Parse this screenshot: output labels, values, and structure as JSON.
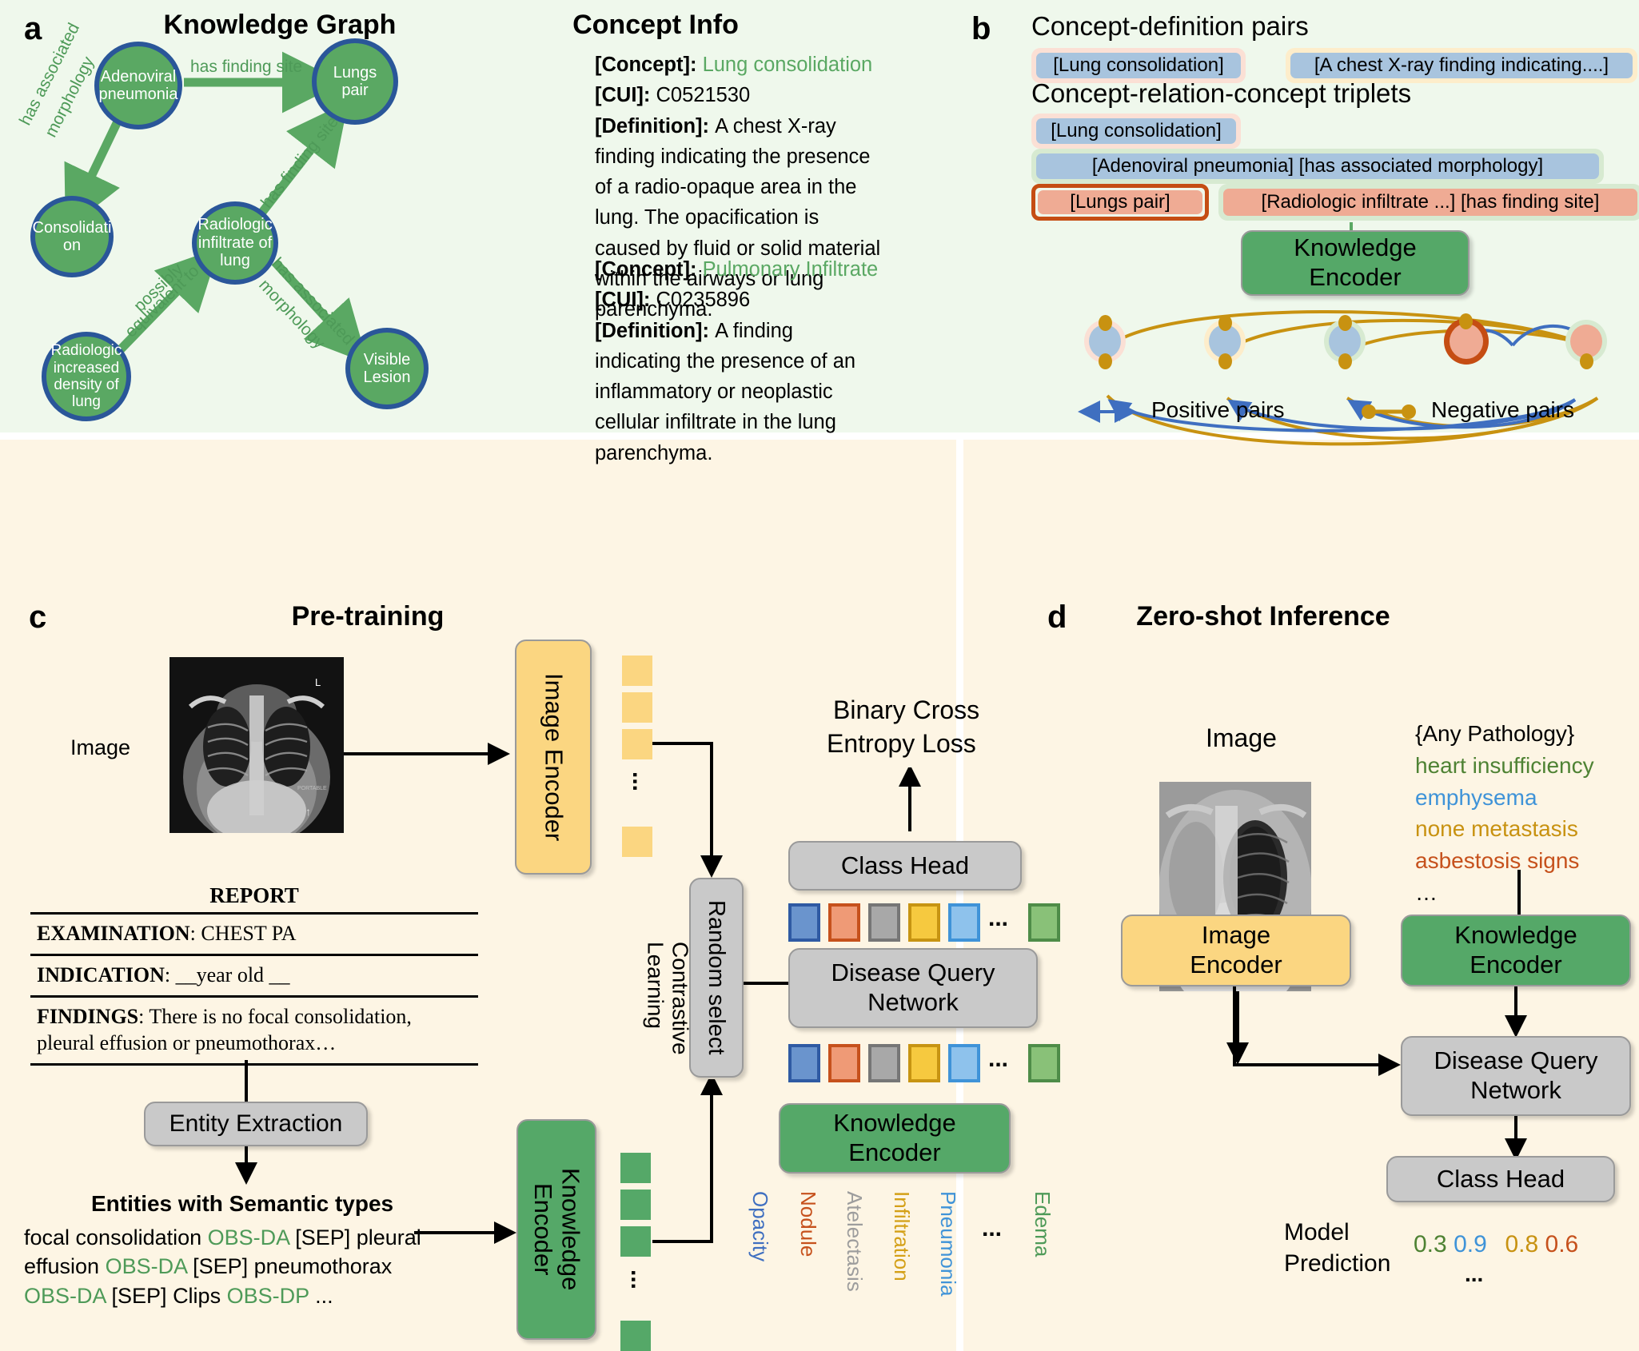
{
  "panels": {
    "a": {
      "letter": "a",
      "title": "Knowledge Graph"
    },
    "b": {
      "letter": "b"
    },
    "c": {
      "letter": "c",
      "title": "Pre-training"
    },
    "d": {
      "letter": "d",
      "title": "Zero-shot Inference"
    }
  },
  "knowledge_graph": {
    "nodes": [
      {
        "id": "adenoviral",
        "label": "Adenoviral pneumonia"
      },
      {
        "id": "lungs_pair",
        "label": "Lungs pair"
      },
      {
        "id": "consolidation",
        "label": "Consolidati on"
      },
      {
        "id": "radiologic_infiltrate",
        "label": "Radiologic infiltrate of lung"
      },
      {
        "id": "radiologic_density",
        "label": "Radiologic increased density of lung"
      },
      {
        "id": "visible_lesion",
        "label": "Visible Lesion"
      }
    ],
    "edges": [
      {
        "from": "adenoviral",
        "to": "lungs_pair",
        "label": "has finding site"
      },
      {
        "from": "adenoviral",
        "to": "consolidation",
        "label": "has associated morphology"
      },
      {
        "from": "radiologic_infiltrate",
        "to": "lungs_pair",
        "label": "has finding site"
      },
      {
        "from": "radiologic_density",
        "to": "radiologic_infiltrate",
        "label": "possibly equivalent to"
      },
      {
        "from": "radiologic_infiltrate",
        "to": "visible_lesion",
        "label": "has associated morphology"
      }
    ],
    "edge_labels": {
      "has_finding_site_top": "has finding site",
      "has_associated_morphology_left_1": "has associated",
      "has_associated_morphology_left_2": "morphology",
      "has_finding_site_diag": "has finding site",
      "has_associated_morphology_diag_1": "has associated",
      "has_associated_morphology_diag_2": "morphology",
      "possibly_1": "possibly",
      "possibly_2": "equivalent to"
    }
  },
  "concept_info": {
    "title": "Concept Info",
    "entries": [
      {
        "concept_key": "[Concept]: ",
        "concept_value": "Lung consolidation",
        "cui_key": "[CUI]: ",
        "cui_value": "C0521530",
        "definition_key": "[Definition]: ",
        "definition_value": "A chest X-ray finding indicating the presence of a radio-opaque area in the lung. The opacification is caused by fluid or solid material within the airways or lung parenchyma."
      },
      {
        "concept_key": "[Concept]: ",
        "concept_value": "Pulmonary Infiltrate",
        "cui_key": "[CUI]: ",
        "cui_value": "C0235896",
        "definition_key": "[Definition]: ",
        "definition_value": "A finding indicating the presence of an inflammatory or neoplastic cellular infiltrate in the lung parenchyma."
      }
    ]
  },
  "panel_b": {
    "pairs_heading": "Concept-definition pairs",
    "triplets_heading": "Concept-relation-concept triplets",
    "chip_concept_pair": "[Lung consolidation]",
    "chip_definition_pair": "[A chest X-ray finding indicating....]",
    "chip_triplet_concept": "[Lung consolidation]",
    "chip_triplet_relation": "[Adenoviral pneumonia]  [has associated morphology]",
    "chip_triplet_target": "[Lungs pair]",
    "chip_triplet_relation2": "[Radiologic infiltrate ...] [has finding site]",
    "knowledge_encoder": "Knowledge\nEncoder",
    "knowledge_encoder_l1": "Knowledge",
    "knowledge_encoder_l2": "Encoder",
    "legend_positive": "Positive  pairs",
    "legend_negative": "Negative pairs",
    "colors": {
      "chip_blue": "#a8c4de",
      "chip_salmon": "#efab94",
      "positive_arrow": "#3f6fc0",
      "negative_link": "#c89211",
      "encoder_green": "#55a868"
    }
  },
  "panel_c": {
    "image_label": "Image",
    "image_encoder_l1": "Image",
    "image_encoder_l2": "Encoder",
    "knowledge_encoder_l1": "Knowledge",
    "knowledge_encoder_l2": "Encoder",
    "contrastive_l1": "Contrastive",
    "contrastive_l2": "Learning",
    "random_select": "Random select",
    "loss_l1": "Binary Cross",
    "loss_l2": "Entropy Loss",
    "class_head": "Class Head",
    "dqn_l1": "Disease Query",
    "dqn_l2": "Network",
    "entity_extraction": "Entity Extraction",
    "entities_title": "Entities with Semantic types",
    "entities_tokens": [
      {
        "t": "focal consolidation ",
        "c": "black"
      },
      {
        "t": "OBS-DA",
        "c": "green"
      },
      {
        "t": " [SEP] pleural",
        "c": "black"
      }
    ],
    "entities_line2": [
      {
        "t": "effusion ",
        "c": "black"
      },
      {
        "t": "OBS-DA",
        "c": "green"
      },
      {
        "t": " [SEP] pneumothorax",
        "c": "black"
      }
    ],
    "entities_line3": [
      {
        "t": "OBS-DA",
        "c": "green"
      },
      {
        "t": " [SEP] Clips ",
        "c": "black"
      },
      {
        "t": "OBS-DP",
        "c": "green"
      },
      {
        "t": " ...",
        "c": "black"
      }
    ],
    "report": {
      "title": "REPORT",
      "examination_key": "EXAMINATION",
      "examination_value": ": CHEST PA",
      "indication_key": "INDICATION",
      "indication_value": ": __year old __",
      "findings_key": "FINDINGS",
      "findings_value": ": There is no focal consolidation, pleural  effusion or pneumothorax…"
    },
    "disease_labels": [
      {
        "label": "Opacity",
        "color": "#3f6fc0"
      },
      {
        "label": "Nodule",
        "color": "#c6511c"
      },
      {
        "label": "Atelectasis",
        "color": "#9d9d9d"
      },
      {
        "label": "Infiltration",
        "color": "#d4a017"
      },
      {
        "label": "Pneumonia",
        "color": "#3f93d8"
      },
      {
        "label": "...",
        "color": "#000000"
      },
      {
        "label": "Edema",
        "color": "#4e9a58"
      }
    ],
    "token_colors": [
      "#6a94cd",
      "#ef9a76",
      "#a8a8a8",
      "#f6c93f",
      "#8ec2ec",
      "dots",
      "#89c178"
    ],
    "token_border_colors": [
      "#2f5aa3",
      "#c6511c",
      "#767676",
      "#c79412",
      "#3f93d8",
      "",
      "#4e8c48"
    ],
    "ellipsis": "..."
  },
  "panel_d": {
    "image_label": "Image",
    "pathology_header": "{Any Pathology}",
    "pathologies": [
      {
        "label": "heart insufficiency",
        "color": "#4e8233"
      },
      {
        "label": "emphysema",
        "color": "#3f93d8"
      },
      {
        "label": "none metastasis",
        "color": "#c89211"
      },
      {
        "label": "asbestosis signs",
        "color": "#c6511c"
      }
    ],
    "pathology_ellipsis": "…",
    "image_encoder_l1": "Image",
    "image_encoder_l2": "Encoder",
    "knowledge_encoder_l1": "Knowledge",
    "knowledge_encoder_l2": "Encoder",
    "dqn_l1": "Disease Query",
    "dqn_l2": "Network",
    "class_head": "Class Head",
    "prediction_label_l1": "Model",
    "prediction_label_l2": "Prediction",
    "predictions": [
      {
        "value": "0.3",
        "color": "#4e8233"
      },
      {
        "value": "0.9",
        "color": "#3f93d8"
      },
      {
        "value": "0.8",
        "color": "#c89211"
      },
      {
        "value": "0.6",
        "color": "#c6511c"
      }
    ],
    "prediction_ellipsis": "..."
  }
}
